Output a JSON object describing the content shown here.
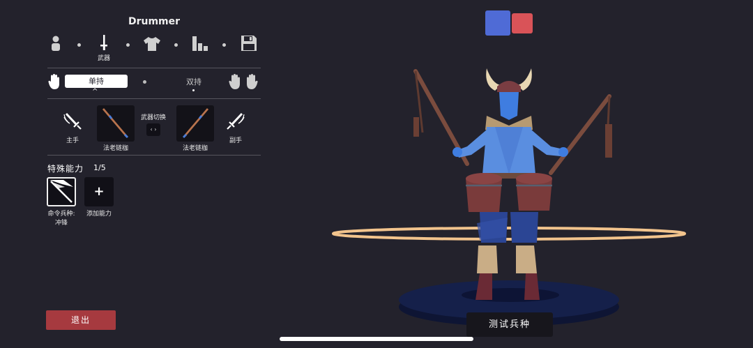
{
  "unit": {
    "name": "Drummer"
  },
  "tabs": [
    {
      "id": "body",
      "label": "",
      "icon": "person-icon"
    },
    {
      "id": "weapon",
      "label": "武器",
      "icon": "sword-icon",
      "active": true
    },
    {
      "id": "clothing",
      "label": "",
      "icon": "shirt-icon"
    },
    {
      "id": "stats",
      "label": "",
      "icon": "bar-chart-icon"
    },
    {
      "id": "save",
      "label": "",
      "icon": "save-icon"
    }
  ],
  "grip": {
    "single_label": "单持",
    "dual_label": "双持",
    "selected": "single"
  },
  "weapons": {
    "main_hand_label": "主手",
    "off_hand_label": "副手",
    "main_weapon_label": "法老链枷",
    "off_weapon_label": "法老链枷",
    "swap_title": "武器切换",
    "swap_button": "‹ ›"
  },
  "abilities": {
    "header": "特殊能力",
    "count": "1/5",
    "items": [
      {
        "label_line1": "命令兵种:",
        "label_line2": "冲锋",
        "icon": "command-charge-icon"
      }
    ],
    "add_label": "添加能力",
    "add_symbol": "+"
  },
  "actions": {
    "exit_label": "退出",
    "test_label": "测试兵种"
  },
  "colors": {
    "background": "#23222c",
    "team_blue": "#4f6bd6",
    "team_red": "#d95358",
    "exit_button": "#a63a3f",
    "unit_body": "#5a8ee0",
    "drum": "#7a3b3b",
    "pedestal": "#15204a",
    "ring": "#f2c48d"
  }
}
